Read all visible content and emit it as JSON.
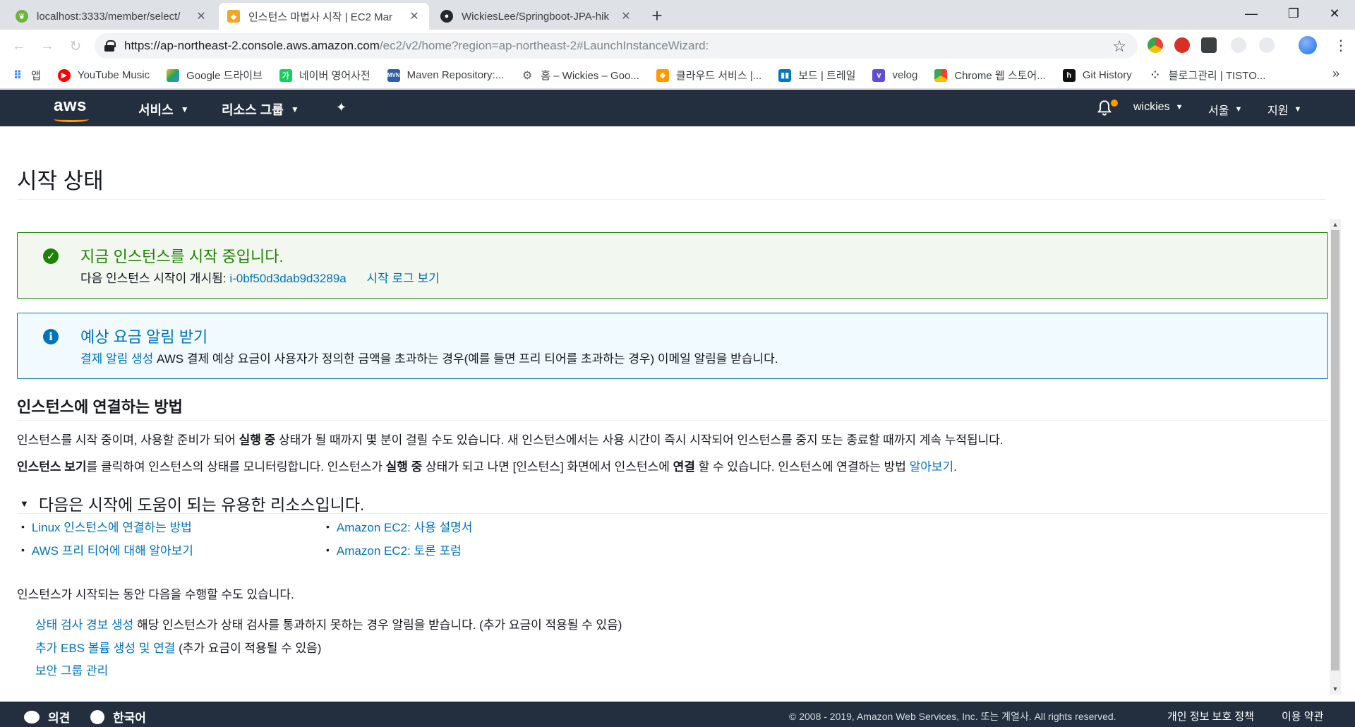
{
  "browser": {
    "tabs": [
      {
        "label": "localhost:3333/member/select/",
        "icon": "spring-leaf-icon",
        "active": false
      },
      {
        "label": "인스턴스 마법사 시작 | EC2 Mar",
        "icon": "aws-cube-icon",
        "active": true
      },
      {
        "label": "WickiesLee/Springboot-JPA-hik",
        "icon": "github-icon",
        "active": false
      }
    ],
    "address": {
      "url_main": "https://ap-northeast-2.console.aws.amazon.com",
      "url_rest": "/ec2/v2/home?region=ap-northeast-2#LaunchInstanceWizard:"
    },
    "bookmarks": [
      {
        "label": "앱",
        "icon": "apps-grid-icon",
        "color": "#4285f4"
      },
      {
        "label": "YouTube Music",
        "icon": "youtube-music-icon",
        "color": "#ff0000"
      },
      {
        "label": "Google 드라이브",
        "icon": "google-drive-icon",
        "color": "#1fa463"
      },
      {
        "label": "네이버 영어사전",
        "icon": "naver-dictionary-icon",
        "color": "#19ce60"
      },
      {
        "label": "Maven Repository:...",
        "icon": "maven-icon",
        "color": "#2d5fa3"
      },
      {
        "label": "홈 – Wickies – Goo...",
        "icon": "gear-icon",
        "color": "#5f6368"
      },
      {
        "label": "클라우드 서비스 |...",
        "icon": "aws-cube-icon",
        "color": "#ff9900"
      },
      {
        "label": "보드 | 트레일",
        "icon": "trello-icon",
        "color": "#0079bf"
      },
      {
        "label": "velog",
        "icon": "velog-icon",
        "color": "#5f4dd6"
      },
      {
        "label": "Chrome 웹 스토어...",
        "icon": "chrome-webstore-icon",
        "color": "#e8453c"
      },
      {
        "label": "Git History",
        "icon": "git-history-icon",
        "color": "#111111"
      },
      {
        "label": "블로그관리 | TISTO...",
        "icon": "tistory-icon",
        "color": "#333333"
      }
    ]
  },
  "aws_nav": {
    "logo": "aws",
    "services": "서비스",
    "resource_groups": "리소스 그룹",
    "user": "wickies",
    "region": "서울",
    "support": "지원"
  },
  "page": {
    "title": "시작 상태",
    "success": {
      "heading": "지금 인스턴스를 시작 중입니다.",
      "body_prefix": "다음 인스턴스 시작이 개시됨:",
      "instance_id": "i-0bf50d3dab9d3289a",
      "log_link": "시작 로그 보기"
    },
    "info": {
      "heading": "예상 요금 알림 받기",
      "link": "결제 알림 생성",
      "body": "AWS 결제 예상 요금이 사용자가 정의한 금액을 초과하는 경우(예를 들면 프리 티어를 초과하는 경우) 이메일 알림을 받습니다."
    },
    "connect": {
      "title": "인스턴스에 연결하는 방법",
      "p1_a": "인스턴스를 시작 중이며, 사용할 준비가 되어 ",
      "p1_b": "실행 중",
      "p1_c": " 상태가 될 때까지 몇 분이 걸릴 수도 있습니다. 새 인스턴스에서는 사용 시간이 즉시 시작되어 인스턴스를 중지 또는 종료할 때까지 계속 누적됩니다.",
      "p2_a": "인스턴스 보기",
      "p2_b": "를 클릭하여 인스턴스의 상태를 모니터링합니다. 인스턴스가 ",
      "p2_c": "실행 중",
      "p2_d": " 상태가 되고 나면 [인스턴스] 화면에서 인스턴스에 ",
      "p2_e": "연결",
      "p2_f": " 할 수 있습니다. 인스턴스에 연결하는 방법 ",
      "p2_link": "알아보기",
      "p2_end": "."
    },
    "resources": {
      "title": "다음은 시작에 도움이 되는 유용한 리소스입니다.",
      "links": [
        "Linux 인스턴스에 연결하는 방법",
        "AWS 프리 티어에 대해 알아보기",
        "Amazon EC2: 사용 설명서",
        "Amazon EC2: 토론 포럼"
      ]
    },
    "while_launching": {
      "intro": "인스턴스가 시작되는 동안 다음을 수행할 수도 있습니다.",
      "items": [
        {
          "link": "상태 검사 경보 생성",
          "text": " 해당 인스턴스가 상태 검사를 통과하지 못하는 경우 알림을 받습니다. (추가 요금이 적용될 수 있음)"
        },
        {
          "link": "추가 EBS 볼륨 생성 및 연결",
          "text": " (추가 요금이 적용될 수 있음)"
        },
        {
          "link": "보안 그룹 관리",
          "text": ""
        }
      ]
    }
  },
  "footer": {
    "feedback": "의견",
    "language": "한국어",
    "copyright": "© 2008 - 2019, Amazon Web Services, Inc. 또는 계열사. All rights reserved.",
    "privacy": "개인 정보 보호 정책",
    "terms": "이용 약관"
  },
  "colors": {
    "aws_nav": "#232f3e",
    "aws_orange": "#ff9900",
    "link": "#0073bb",
    "success": "#1d8102"
  }
}
